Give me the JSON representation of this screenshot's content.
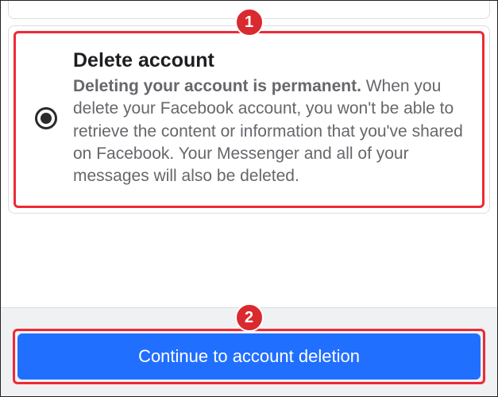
{
  "option": {
    "title": "Delete account",
    "desc_bold": "Deleting your account is permanent.",
    "desc_rest": " When you delete your Facebook account, you won't be able to retrieve the content or information that you've shared on Facebook. Your Messenger and all of your messages will also be deleted."
  },
  "footer": {
    "continue_label": "Continue to account deletion"
  },
  "callouts": {
    "one": "1",
    "two": "2"
  }
}
